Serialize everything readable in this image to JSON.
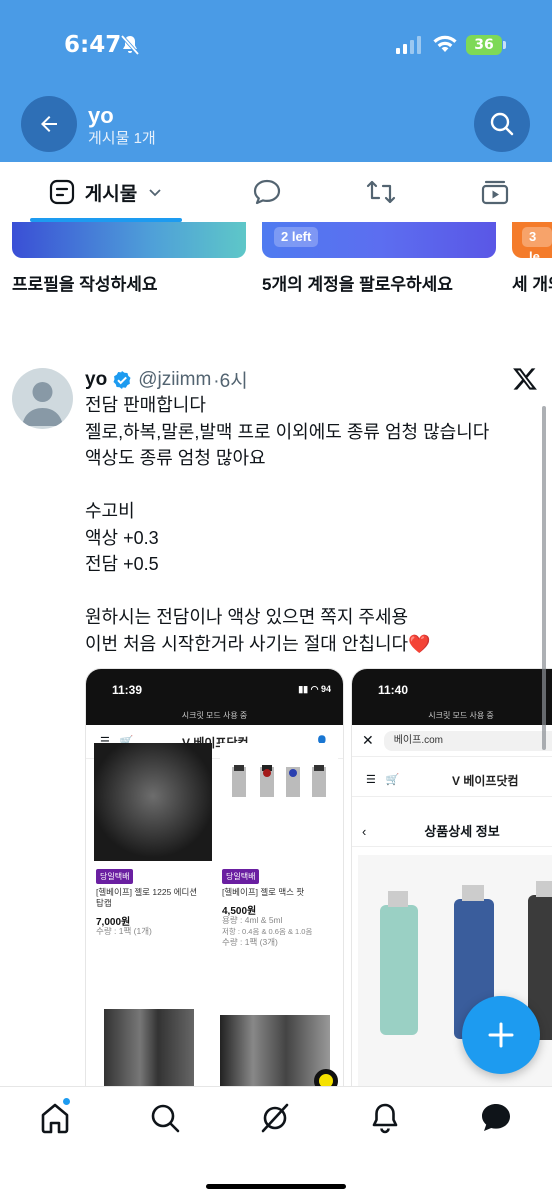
{
  "status_bar": {
    "time": "6:47",
    "battery": "36"
  },
  "profile": {
    "name": "yo",
    "post_count": "게시물 1개"
  },
  "tabs": {
    "posts_label": "게시물"
  },
  "suggestion_cards": [
    {
      "title": "프로필을 작성하세요"
    },
    {
      "title": "5개의 계정을 팔로우하세요",
      "pill": "2 left"
    },
    {
      "title": "세 개의",
      "pill": "3 le"
    }
  ],
  "tweet": {
    "name": "yo",
    "handle": "@jziimm",
    "time": "·6시",
    "lines": [
      "전담 판매합니다",
      "젤로,하복,말론,발맥 프로 이외에도 종류 엄청 많습니다",
      "액상도 종류 엄청 많아요",
      "",
      "수고비",
      "액상 +0.3",
      "전담 +0.5",
      "",
      "원하시는 전담이나 액상 있으면 쪽지 주세용",
      "이번 처음 시작한거라 사기는 절대 안칩니다❤️"
    ]
  },
  "media_1": {
    "time": "11:39",
    "secret_mode": "시크릿 모드 사용 중",
    "logo": "V 베이프닷컴",
    "product_1": {
      "badge": "당일택배",
      "name_line1": "[헬베이프] 젤로 1225 에디션",
      "name_line2": "탑캡",
      "price": "7,000원",
      "qty": "수량 : 1팩 (1개)"
    },
    "product_2": {
      "badge": "당일택배",
      "name_line1": "[헬베이프] 젤로 맥스 팟",
      "price": "4,500원",
      "spec1": "용량 : 4ml & 5ml",
      "spec2": "저항 : 0.4옴 & 0.6옴 & 1.0옴",
      "qty": "수량 : 1팩 (3개)"
    }
  },
  "media_2": {
    "time": "11:40",
    "secret_mode": "시크릿 모드 사용 중",
    "url": "베이프.com",
    "logo": "V 베이프닷컴",
    "page_title": "상품상세 정보"
  },
  "colors": {
    "header": "#4a9be6",
    "accent": "#1d9bf0"
  }
}
